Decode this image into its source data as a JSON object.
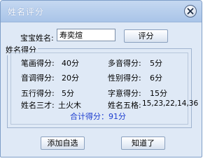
{
  "window": {
    "title": "姓名评分"
  },
  "form": {
    "baby_name_label": "宝宝姓名:",
    "baby_name_value": "寿奕煊",
    "score_button": "评分"
  },
  "results": {
    "group_title": "姓名得分",
    "rows": [
      {
        "left_label": "笔画得分:",
        "left_value": "40分",
        "right_label": "多音得分:",
        "right_value": "5分"
      },
      {
        "left_label": "音调得分:",
        "left_value": "20分",
        "right_label": "性别得分:",
        "right_value": "6分"
      },
      {
        "left_label": "五行得分:",
        "left_value": "5分",
        "right_label": "字意得分:",
        "right_value": "15分"
      },
      {
        "left_label": "姓名三才:",
        "left_value": "土火木",
        "right_label": "姓名五格:",
        "right_value": "15,23,22,14,36"
      }
    ],
    "total_text": "合计得分：91分"
  },
  "buttons": {
    "add_favorite": "添加自选",
    "ok": "知道了"
  },
  "colors": {
    "total_text": "#1f3fd0",
    "dialog_bg": "#dfe9f6",
    "titlebar": "#b8cfee"
  }
}
